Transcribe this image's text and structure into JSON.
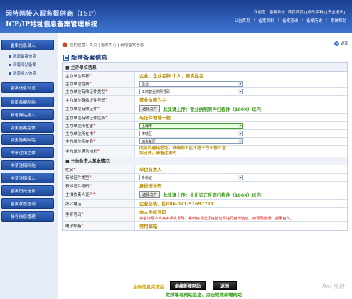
{
  "header": {
    "title_line1": "因特网接入服务提供商（ISP）",
    "title_line2": "ICP/IP地址信息备案管理系统",
    "welcome_prefix": "欢迎您：",
    "username": "备案系统",
    "welcome_links": "[首页首页] [修改资料] [安全退出]",
    "nav": [
      "公告首页",
      "备案资料",
      "备案查询",
      "备案历史",
      "系统帮助"
    ]
  },
  "sidebar": {
    "groups": [
      {
        "label": "备案信息录入"
      },
      {
        "label": "备案信息浏览"
      },
      {
        "label": "新增备案网站"
      },
      {
        "label": "新增网站接入"
      },
      {
        "label": "变更备案主体"
      },
      {
        "label": "变更备案网站"
      },
      {
        "label": "申请注销主体"
      },
      {
        "label": "申请注销网站"
      },
      {
        "label": "申请注销接入"
      },
      {
        "label": "备案历史信息"
      },
      {
        "label": "备案状态查询"
      },
      {
        "label": "帐号信息管理"
      }
    ],
    "sub_items": [
      "新增备案信息",
      "新增网站备案",
      "新增接入信息"
    ]
  },
  "breadcrumb": {
    "text": "您的位置：首页 | 备案中心 | 新增备案信息",
    "back": "返回"
  },
  "page_title": "新增备案信息",
  "sections": {
    "org": "■ 主办单位信息",
    "person": "■ 主体负责人基本情况"
  },
  "org_rows": [
    {
      "label": "主办单位名称",
      "required": true,
      "type": "text",
      "value": "企业：企业名称  个人：真实姓名"
    },
    {
      "label": "主办单位性质",
      "required": true,
      "type": "select",
      "value": "企业"
    },
    {
      "label": "主办单位有效证件类型",
      "required": true,
      "type": "select",
      "value": "工商营业执照号码"
    },
    {
      "label": "主办单位有效证件号码",
      "required": true,
      "type": "text",
      "value": "营业执照为主"
    },
    {
      "label": "主办单位有效证件",
      "required": true,
      "type": "file",
      "button": "选择文件",
      "value": "此处请上传：营业执照原件扫描件（100K）以内"
    },
    {
      "label": "主办单位有效证件住所",
      "required": true,
      "type": "text",
      "value": "与证件地址一致"
    },
    {
      "label": "主办单位所在省",
      "required": true,
      "type": "select-green",
      "value": "上海市"
    },
    {
      "label": "主办单位所在市",
      "required": true,
      "type": "select",
      "value": "市辖区"
    },
    {
      "label": "主办单位所在县",
      "required": true,
      "type": "select",
      "value": "浦东新区"
    },
    {
      "label": "主办单位通信地址",
      "required": true,
      "type": "text2",
      "value": "同公司通讯地址，详细到＊区＊路＊号＊栋＊室",
      "value2": "如已详，请备注说明"
    }
  ],
  "person_rows": [
    {
      "label": "姓名",
      "required": true,
      "type": "text",
      "value": "单位负责人"
    },
    {
      "label": "有效证件类型",
      "required": true,
      "type": "select",
      "value": "身份证"
    },
    {
      "label": "有效证件号码",
      "required": true,
      "type": "text",
      "value": "身份证号码"
    },
    {
      "label": "主体负责人证件",
      "required": true,
      "type": "file",
      "button": "选择文件",
      "value": "此处请上传：身份证正反面扫描件（100K）以内"
    },
    {
      "label": "办公电话",
      "required": false,
      "type": "text",
      "value": "企业必填，如086-021-51697771"
    },
    {
      "label": "手机号码",
      "required": true,
      "type": "mobile",
      "value": "本人手机号码",
      "note": "务必填写本人真实手机号码，系统将发送短信验证码进行身份验证，如号码错误，后果自负。"
    },
    {
      "label": "电子邮箱",
      "required": true,
      "type": "text",
      "value": "常用邮箱"
    }
  ],
  "bottom": {
    "prefix": "主体信息完成后",
    "continue_button": "继续新增网站",
    "back_button": "返回",
    "note": "继续填写网站信息，点击继续新增网站"
  },
  "watermark": "Bai 经验",
  "colors": {
    "header": "#2d5cb5",
    "hint_yellow": "#b58a00",
    "hint_green": "#3a9a1a",
    "required": "#dd0000"
  }
}
